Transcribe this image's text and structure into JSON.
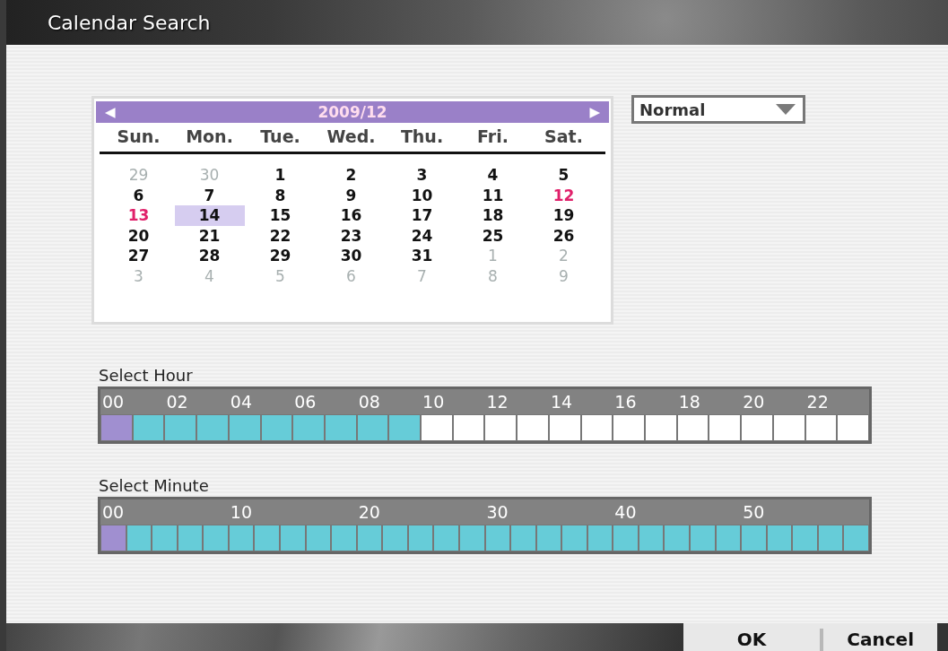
{
  "window": {
    "title": "Calendar Search"
  },
  "calendar": {
    "month_label": "2009/12",
    "prev_icon": "◀",
    "next_icon": "▶",
    "weekdays": [
      "Sun.",
      "Mon.",
      "Tue.",
      "Wed.",
      "Thu.",
      "Fri.",
      "Sat."
    ],
    "days": [
      {
        "label": "29",
        "in_month": false,
        "selected": false,
        "marked": false
      },
      {
        "label": "30",
        "in_month": false,
        "selected": false,
        "marked": false
      },
      {
        "label": "1",
        "in_month": true,
        "selected": false,
        "marked": false
      },
      {
        "label": "2",
        "in_month": true,
        "selected": false,
        "marked": false
      },
      {
        "label": "3",
        "in_month": true,
        "selected": false,
        "marked": false
      },
      {
        "label": "4",
        "in_month": true,
        "selected": false,
        "marked": false
      },
      {
        "label": "5",
        "in_month": true,
        "selected": false,
        "marked": false
      },
      {
        "label": "6",
        "in_month": true,
        "selected": false,
        "marked": false
      },
      {
        "label": "7",
        "in_month": true,
        "selected": false,
        "marked": false
      },
      {
        "label": "8",
        "in_month": true,
        "selected": false,
        "marked": false
      },
      {
        "label": "9",
        "in_month": true,
        "selected": false,
        "marked": false
      },
      {
        "label": "10",
        "in_month": true,
        "selected": false,
        "marked": false
      },
      {
        "label": "11",
        "in_month": true,
        "selected": false,
        "marked": false
      },
      {
        "label": "12",
        "in_month": true,
        "selected": false,
        "marked": true
      },
      {
        "label": "13",
        "in_month": true,
        "selected": false,
        "marked": true
      },
      {
        "label": "14",
        "in_month": true,
        "selected": true,
        "marked": false
      },
      {
        "label": "15",
        "in_month": true,
        "selected": false,
        "marked": false
      },
      {
        "label": "16",
        "in_month": true,
        "selected": false,
        "marked": false
      },
      {
        "label": "17",
        "in_month": true,
        "selected": false,
        "marked": false
      },
      {
        "label": "18",
        "in_month": true,
        "selected": false,
        "marked": false
      },
      {
        "label": "19",
        "in_month": true,
        "selected": false,
        "marked": false
      },
      {
        "label": "20",
        "in_month": true,
        "selected": false,
        "marked": false
      },
      {
        "label": "21",
        "in_month": true,
        "selected": false,
        "marked": false
      },
      {
        "label": "22",
        "in_month": true,
        "selected": false,
        "marked": false
      },
      {
        "label": "23",
        "in_month": true,
        "selected": false,
        "marked": false
      },
      {
        "label": "24",
        "in_month": true,
        "selected": false,
        "marked": false
      },
      {
        "label": "25",
        "in_month": true,
        "selected": false,
        "marked": false
      },
      {
        "label": "26",
        "in_month": true,
        "selected": false,
        "marked": false
      },
      {
        "label": "27",
        "in_month": true,
        "selected": false,
        "marked": false
      },
      {
        "label": "28",
        "in_month": true,
        "selected": false,
        "marked": false
      },
      {
        "label": "29",
        "in_month": true,
        "selected": false,
        "marked": false
      },
      {
        "label": "30",
        "in_month": true,
        "selected": false,
        "marked": false
      },
      {
        "label": "31",
        "in_month": true,
        "selected": false,
        "marked": false
      },
      {
        "label": "1",
        "in_month": false,
        "selected": false,
        "marked": false
      },
      {
        "label": "2",
        "in_month": false,
        "selected": false,
        "marked": false
      },
      {
        "label": "3",
        "in_month": false,
        "selected": false,
        "marked": false
      },
      {
        "label": "4",
        "in_month": false,
        "selected": false,
        "marked": false
      },
      {
        "label": "5",
        "in_month": false,
        "selected": false,
        "marked": false
      },
      {
        "label": "6",
        "in_month": false,
        "selected": false,
        "marked": false
      },
      {
        "label": "7",
        "in_month": false,
        "selected": false,
        "marked": false
      },
      {
        "label": "8",
        "in_month": false,
        "selected": false,
        "marked": false
      },
      {
        "label": "9",
        "in_month": false,
        "selected": false,
        "marked": false
      }
    ]
  },
  "mode_dropdown": {
    "value": "Normal"
  },
  "hour_select": {
    "title": "Select Hour",
    "labels": [
      "00",
      "02",
      "04",
      "06",
      "08",
      "10",
      "12",
      "14",
      "16",
      "18",
      "20",
      "22"
    ],
    "cells": [
      {
        "selected": true,
        "recorded": true
      },
      {
        "selected": false,
        "recorded": true
      },
      {
        "selected": false,
        "recorded": true
      },
      {
        "selected": false,
        "recorded": true
      },
      {
        "selected": false,
        "recorded": true
      },
      {
        "selected": false,
        "recorded": true
      },
      {
        "selected": false,
        "recorded": true
      },
      {
        "selected": false,
        "recorded": true
      },
      {
        "selected": false,
        "recorded": true
      },
      {
        "selected": false,
        "recorded": true
      },
      {
        "selected": false,
        "recorded": false
      },
      {
        "selected": false,
        "recorded": false
      },
      {
        "selected": false,
        "recorded": false
      },
      {
        "selected": false,
        "recorded": false
      },
      {
        "selected": false,
        "recorded": false
      },
      {
        "selected": false,
        "recorded": false
      },
      {
        "selected": false,
        "recorded": false
      },
      {
        "selected": false,
        "recorded": false
      },
      {
        "selected": false,
        "recorded": false
      },
      {
        "selected": false,
        "recorded": false
      },
      {
        "selected": false,
        "recorded": false
      },
      {
        "selected": false,
        "recorded": false
      },
      {
        "selected": false,
        "recorded": false
      },
      {
        "selected": false,
        "recorded": false
      }
    ]
  },
  "minute_select": {
    "title": "Select Minute",
    "labels": [
      "00",
      "10",
      "20",
      "30",
      "40",
      "50"
    ],
    "cells": [
      {
        "selected": true,
        "recorded": true
      },
      {
        "selected": false,
        "recorded": true
      },
      {
        "selected": false,
        "recorded": true
      },
      {
        "selected": false,
        "recorded": true
      },
      {
        "selected": false,
        "recorded": true
      },
      {
        "selected": false,
        "recorded": true
      },
      {
        "selected": false,
        "recorded": true
      },
      {
        "selected": false,
        "recorded": true
      },
      {
        "selected": false,
        "recorded": true
      },
      {
        "selected": false,
        "recorded": true
      },
      {
        "selected": false,
        "recorded": true
      },
      {
        "selected": false,
        "recorded": true
      },
      {
        "selected": false,
        "recorded": true
      },
      {
        "selected": false,
        "recorded": true
      },
      {
        "selected": false,
        "recorded": true
      },
      {
        "selected": false,
        "recorded": true
      },
      {
        "selected": false,
        "recorded": true
      },
      {
        "selected": false,
        "recorded": true
      },
      {
        "selected": false,
        "recorded": true
      },
      {
        "selected": false,
        "recorded": true
      },
      {
        "selected": false,
        "recorded": true
      },
      {
        "selected": false,
        "recorded": true
      },
      {
        "selected": false,
        "recorded": true
      },
      {
        "selected": false,
        "recorded": true
      },
      {
        "selected": false,
        "recorded": true
      },
      {
        "selected": false,
        "recorded": true
      },
      {
        "selected": false,
        "recorded": true
      },
      {
        "selected": false,
        "recorded": true
      },
      {
        "selected": false,
        "recorded": true
      },
      {
        "selected": false,
        "recorded": true
      }
    ]
  },
  "buttons": [
    "OK",
    "Cancel"
  ]
}
